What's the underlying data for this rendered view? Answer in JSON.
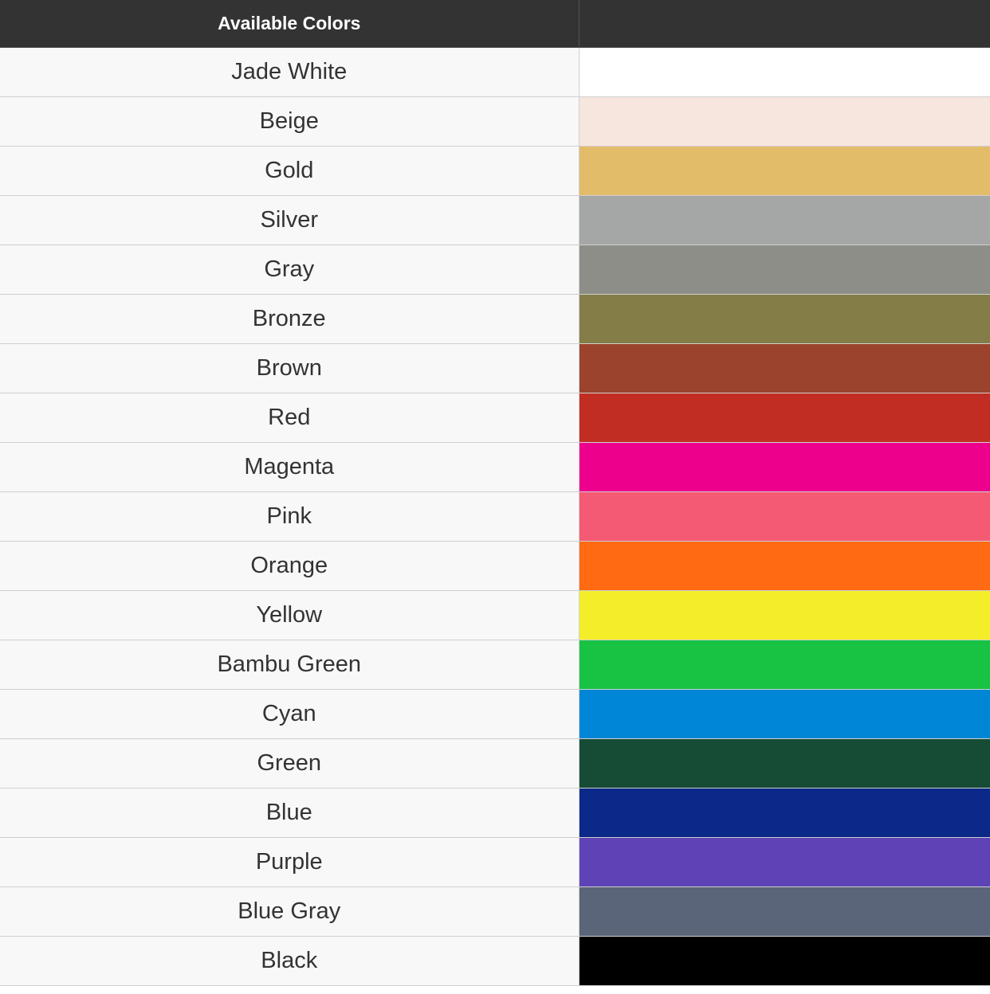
{
  "header": {
    "name_column": "Available Colors",
    "swatch_column": ""
  },
  "colors": [
    {
      "name": "Jade White",
      "hex": "#ffffff"
    },
    {
      "name": "Beige",
      "hex": "#f7e6de"
    },
    {
      "name": "Gold",
      "hex": "#e3bc6a"
    },
    {
      "name": "Silver",
      "hex": "#a5a7a7"
    },
    {
      "name": "Gray",
      "hex": "#8e8e88"
    },
    {
      "name": "Bronze",
      "hex": "#847d48"
    },
    {
      "name": "Brown",
      "hex": "#9b432c"
    },
    {
      "name": "Red",
      "hex": "#c12d22"
    },
    {
      "name": "Magenta",
      "hex": "#ec008c"
    },
    {
      "name": "Pink",
      "hex": "#f55a74"
    },
    {
      "name": "Orange",
      "hex": "#ff6a13"
    },
    {
      "name": "Yellow",
      "hex": "#f4ee2a"
    },
    {
      "name": "Bambu Green",
      "hex": "#18c344"
    },
    {
      "name": "Cyan",
      "hex": "#0086d6"
    },
    {
      "name": "Green",
      "hex": "#164b35"
    },
    {
      "name": "Blue",
      "hex": "#0a2989"
    },
    {
      "name": "Purple",
      "hex": "#5e43b7"
    },
    {
      "name": "Blue Gray",
      "hex": "#5b6579"
    },
    {
      "name": "Black",
      "hex": "#000000"
    }
  ]
}
